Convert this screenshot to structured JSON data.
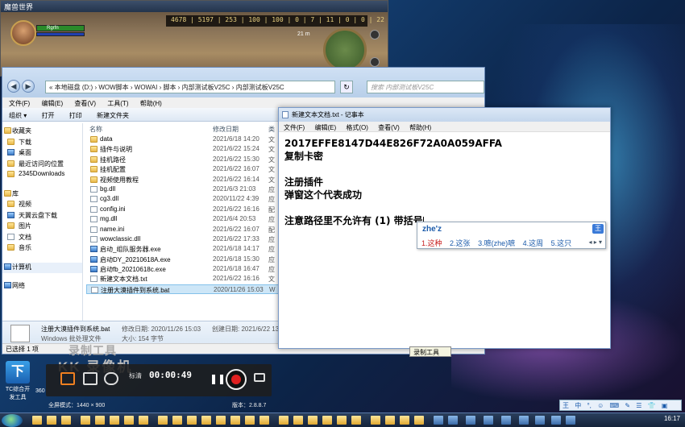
{
  "game": {
    "title": "魔兽世界",
    "hud": "4678 | 5197 | 253 | 100 | 100 | 0 | 7 | 11 | 0 | 0 | 22 | 0 | 90 | 0",
    "player_name": "Rgrfn",
    "time": "21 m"
  },
  "explorer": {
    "address": "« 本地磁盘 (D:) › WOW脚本 › WOWAI › 脚本 › 内部测试板V25C › 内部测试板V25C",
    "search_placeholder": "搜索 内部测试板V25C",
    "menu": [
      "文件(F)",
      "编辑(E)",
      "查看(V)",
      "工具(T)",
      "帮助(H)"
    ],
    "toolbar": [
      "组织 ▾",
      "打开",
      "打印",
      "新建文件夹"
    ],
    "nav": {
      "favorites": "收藏夹",
      "fav_items": [
        "下载",
        "桌面",
        "最近访问的位置",
        "2345Downloads"
      ],
      "library": "库",
      "lib_items": [
        "视频",
        "天翼云盘下载",
        "图片",
        "文档",
        "音乐"
      ],
      "computer": "计算机",
      "network": "网络"
    },
    "columns": {
      "name": "名称",
      "date": "修改日期",
      "type": "类"
    },
    "files": [
      {
        "name": "data",
        "date": "2021/6/18 14:20",
        "type": "文",
        "kind": "folder"
      },
      {
        "name": "插件与说明",
        "date": "2021/6/22 15:24",
        "type": "文",
        "kind": "folder"
      },
      {
        "name": "挂机路径",
        "date": "2021/6/22 15:30",
        "type": "文",
        "kind": "folder"
      },
      {
        "name": "挂机配置",
        "date": "2021/6/22 16:07",
        "type": "文",
        "kind": "folder"
      },
      {
        "name": "视频使用教程",
        "date": "2021/6/22 16:14",
        "type": "文",
        "kind": "folder"
      },
      {
        "name": "bg.dll",
        "date": "2021/6/3 21:03",
        "type": "应",
        "kind": "doc"
      },
      {
        "name": "cg3.dll",
        "date": "2020/11/22 4:39",
        "type": "应",
        "kind": "doc"
      },
      {
        "name": "config.ini",
        "date": "2021/6/22 16:16",
        "type": "配",
        "kind": "doc"
      },
      {
        "name": "mg.dll",
        "date": "2021/6/4 20:53",
        "type": "应",
        "kind": "doc"
      },
      {
        "name": "name.ini",
        "date": "2021/6/22 16:07",
        "type": "配",
        "kind": "doc"
      },
      {
        "name": "wowclassic.dll",
        "date": "2021/6/22 17:33",
        "type": "应",
        "kind": "doc"
      },
      {
        "name": "启动_组队服务器.exe",
        "date": "2021/6/18 14:17",
        "type": "应",
        "kind": "exe"
      },
      {
        "name": "启动DY_20210618A.exe",
        "date": "2021/6/18 15:30",
        "type": "应",
        "kind": "exe"
      },
      {
        "name": "启动fb_20210618c.exe",
        "date": "2021/6/18 16:47",
        "type": "应",
        "kind": "exe"
      },
      {
        "name": "新建文本文档.txt",
        "date": "2021/6/22 16:16",
        "type": "文",
        "kind": "doc"
      },
      {
        "name": "注册大漠插件到系统.bat",
        "date": "2020/11/26 15:03",
        "type": "W",
        "kind": "doc"
      }
    ],
    "details": {
      "name": "注册大漠插件到系统.bat",
      "modified_label": "修改日期: 2020/11/26 15:03",
      "created_label": "创建日期: 2021/6/22 13:38",
      "type": "Windows 批处理文件",
      "size_label": "大小: 154 字节"
    },
    "status": "已选择 1 项"
  },
  "notepad": {
    "title": "新建文本文档.txt - 记事本",
    "menu": [
      "文件(F)",
      "编辑(E)",
      "格式(O)",
      "查看(V)",
      "帮助(H)"
    ],
    "lines": [
      "2017EFFE8147D44E826F72A0A059AFFA",
      "复制卡密",
      "",
      "注册插件",
      "弹窗这个代表成功",
      "",
      "注意路径里不允许有 (1) 带括号"
    ]
  },
  "ime": {
    "input": "zhe'z",
    "logo": "王",
    "candidates": [
      "1.这种",
      "2.这张",
      "3.嗻(zhe)嗻",
      "4.这周",
      "5.这只"
    ],
    "arrows": "◂ ▸ ▾"
  },
  "recorder": {
    "logo_top": "录制工具",
    "logo_bottom": "KK 录像机",
    "mode_label": "标清",
    "time": "00:00:49",
    "pause": "❚❚",
    "fullscreen_label": "全屏模式：1440 × 900",
    "version_label": "版本：2.8.8.7",
    "tooltip": "录制工具"
  },
  "desktop_icon": {
    "label": "TC综合开发工具",
    "label2": "360",
    "glyph": "下"
  },
  "ime_bar": [
    "王",
    "中",
    "°,",
    "☺",
    "⌨",
    "✎",
    "☰",
    "👕",
    "▣"
  ],
  "clock": "16:17"
}
